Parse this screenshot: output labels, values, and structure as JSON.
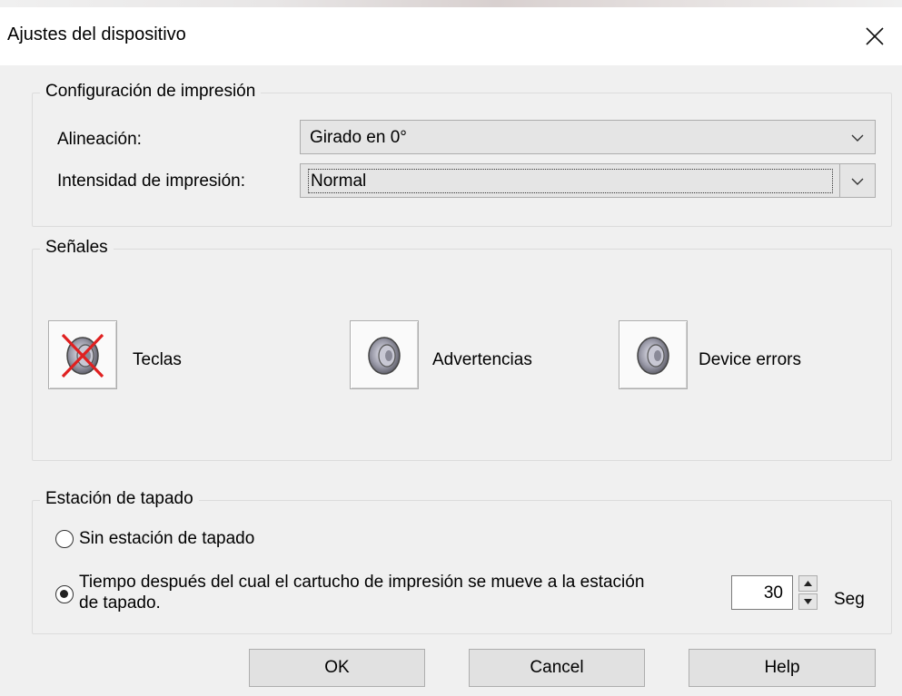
{
  "dialog": {
    "title": "Ajustes del dispositivo"
  },
  "print_config": {
    "legend": "Configuración de impresión",
    "alignment_label": "Alineación:",
    "alignment_value": "Girado en 0°",
    "intensity_label": "Intensidad de impresión:",
    "intensity_value": "Normal"
  },
  "signals": {
    "legend": "Señales",
    "items": [
      {
        "label": "Teclas",
        "icon": "speaker-muted-icon",
        "muted": true
      },
      {
        "label": "Advertencias",
        "icon": "speaker-icon",
        "muted": false
      },
      {
        "label": "Device errors",
        "icon": "speaker-icon",
        "muted": false
      }
    ]
  },
  "capping": {
    "legend": "Estación de tapado",
    "option1": "Sin estación de tapado",
    "option2_line1": "Tiempo después del cual el cartucho de impresión se mueve a la estación",
    "option2_line2": "de tapado.",
    "selected": "option2",
    "seconds_value": "30",
    "seconds_unit": "Seg"
  },
  "buttons": {
    "ok": "OK",
    "cancel": "Cancel",
    "help": "Help"
  },
  "colors": {
    "background": "#f0f0f0",
    "titlebar": "#ffffff",
    "button": "#e1e1e1",
    "border": "#adadad",
    "mute_x": "#e02020"
  }
}
